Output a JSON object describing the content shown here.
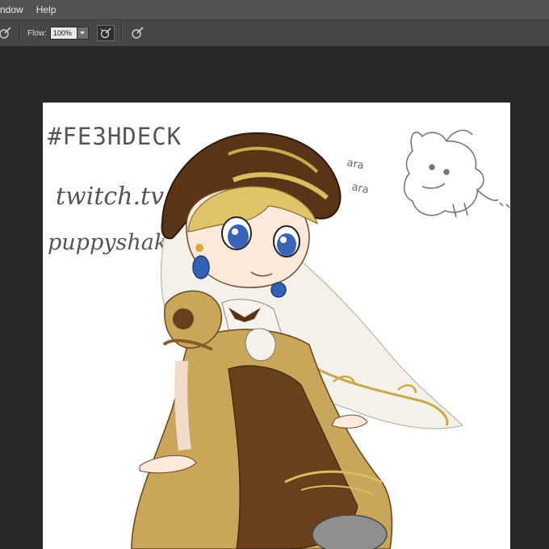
{
  "menubar": {
    "items": [
      "ndow",
      "Help"
    ]
  },
  "options": {
    "flow_label": "Flow:",
    "flow_value": "100%"
  },
  "canvas": {
    "art_text": {
      "hashtag": "#FE3HDECK",
      "line1": "twitch.tv",
      "line2": "puppyshaker",
      "sfx1": "ara",
      "sfx2": "ara"
    }
  },
  "colors": {
    "menubar": "#535353",
    "optionsbar": "#474747",
    "workspace": "#282828",
    "canvas": "#ffffff"
  }
}
